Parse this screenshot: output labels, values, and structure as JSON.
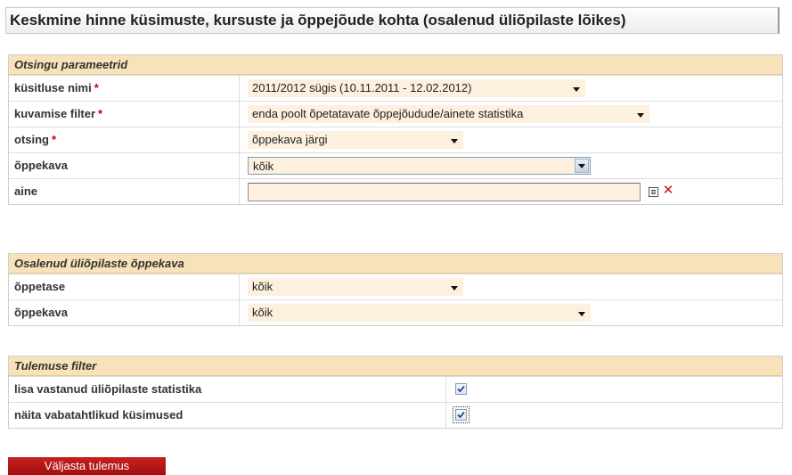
{
  "page_title": "Keskmine hinne küsimuste, kursuste ja õppejõude kohta (osalenud üliõpilaste lõikes)",
  "search_params": {
    "header": "Otsingu parameetrid",
    "survey_name": {
      "label": "küsitluse nimi",
      "required_mark": "*",
      "value": "2011/2012 sügis (10.11.2011 - 12.02.2012)"
    },
    "display_filter": {
      "label": "kuvamise filter",
      "required_mark": "*",
      "value": "enda poolt õpetatavate õppejõudude/ainete statistika"
    },
    "search": {
      "label": "otsing",
      "required_mark": "*",
      "value": "õppekava järgi"
    },
    "curriculum": {
      "label": "õppekava",
      "value": "kõik"
    },
    "subject": {
      "label": "aine",
      "value": ""
    }
  },
  "student_curriculum": {
    "header": "Osalenud üliõpilaste õppekava",
    "study_level": {
      "label": "õppetase",
      "value": "kõik"
    },
    "curriculum": {
      "label": "õppekava",
      "value": "kõik"
    }
  },
  "result_filter": {
    "header": "Tulemuse filter",
    "add_respondent_stats": {
      "label": "lisa vastanud üliõpilaste statistika",
      "checked": true
    },
    "show_optional_questions": {
      "label": "näita vabatahtlikud küsimused",
      "checked": true
    }
  },
  "submit_label": "Väljasta tulemus",
  "icons": {
    "select_list": "list-icon",
    "clear": "clear-x-icon",
    "dropdown": "chevron-down-icon"
  }
}
